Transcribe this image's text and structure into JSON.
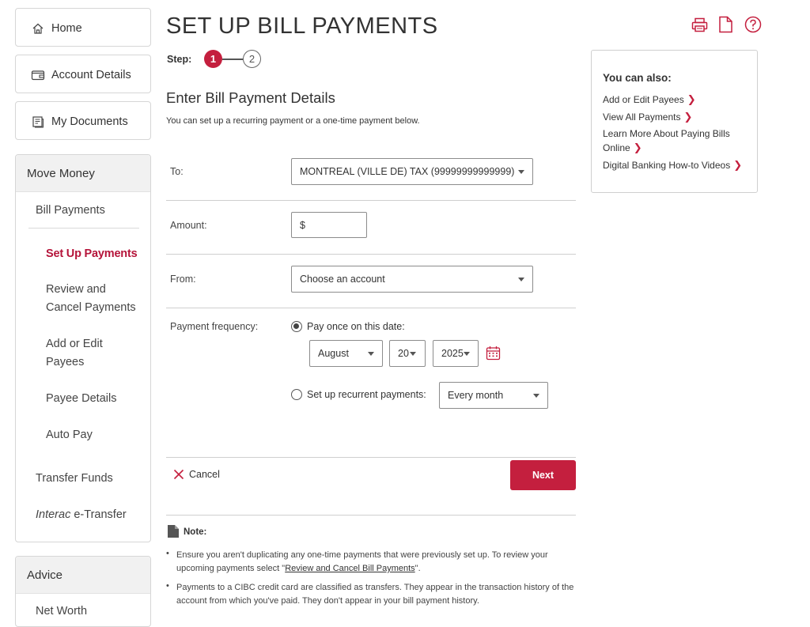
{
  "nav": {
    "home": "Home",
    "account_details": "Account Details",
    "my_documents": "My Documents",
    "move_money": {
      "header": "Move Money",
      "bill_payments": "Bill Payments",
      "set_up_payments": "Set Up Payments",
      "review_cancel_1": "Review and",
      "review_cancel_2": "Cancel Payments",
      "add_edit_1": "Add or Edit",
      "add_edit_2": "Payees",
      "payee_details": "Payee Details",
      "auto_pay": "Auto Pay",
      "transfer_funds": "Transfer Funds",
      "interac_italic": "Interac",
      "interac_rest": " e-Transfer"
    },
    "advice": {
      "header": "Advice",
      "net_worth": "Net Worth"
    }
  },
  "page": {
    "title": "SET UP BILL PAYMENTS",
    "step_label": "Step:",
    "steps": [
      "1",
      "2"
    ],
    "section_title": "Enter Bill Payment Details",
    "section_desc": "You can set up a recurring payment or a one-time payment below."
  },
  "form": {
    "to_label": "To:",
    "to_value": "MONTREAL (VILLE DE) TAX (99999999999999)",
    "amount_label": "Amount:",
    "amount_prefix": "$",
    "from_label": "From:",
    "from_value": "Choose an account",
    "frequency_label": "Payment frequency:",
    "pay_once_label": "Pay once on this date:",
    "month": "August",
    "day": "20",
    "year": "2025",
    "recurrent_label": "Set up recurrent payments:",
    "recurrent_value": "Every month",
    "cancel": "Cancel",
    "next": "Next"
  },
  "note": {
    "label": "Note:",
    "item1_pre": "Ensure you aren't duplicating any one-time payments that were previously set up. To review your upcoming payments select \"",
    "item1_link": "Review and Cancel Bill Payments",
    "item1_post": "\".",
    "item2": "Payments to a CIBC credit card are classified as transfers. They appear in the transaction history of the account from which you've paid. They don't appear in your bill payment history."
  },
  "side": {
    "title": "You can also:",
    "links": [
      "Add or Edit Payees",
      "View All Payments",
      "Learn More About Paying Bills",
      "Online",
      "Digital Banking How-to Videos"
    ]
  },
  "colors": {
    "brand_red": "#c41f3e",
    "active_nav": "#b5143a"
  },
  "icons": [
    "home-icon",
    "wallet-icon",
    "documents-icon",
    "print-icon",
    "document-icon",
    "help-icon",
    "calendar-icon",
    "close-icon",
    "note-icon",
    "chevron-right-icon",
    "chevron-down-icon"
  ]
}
